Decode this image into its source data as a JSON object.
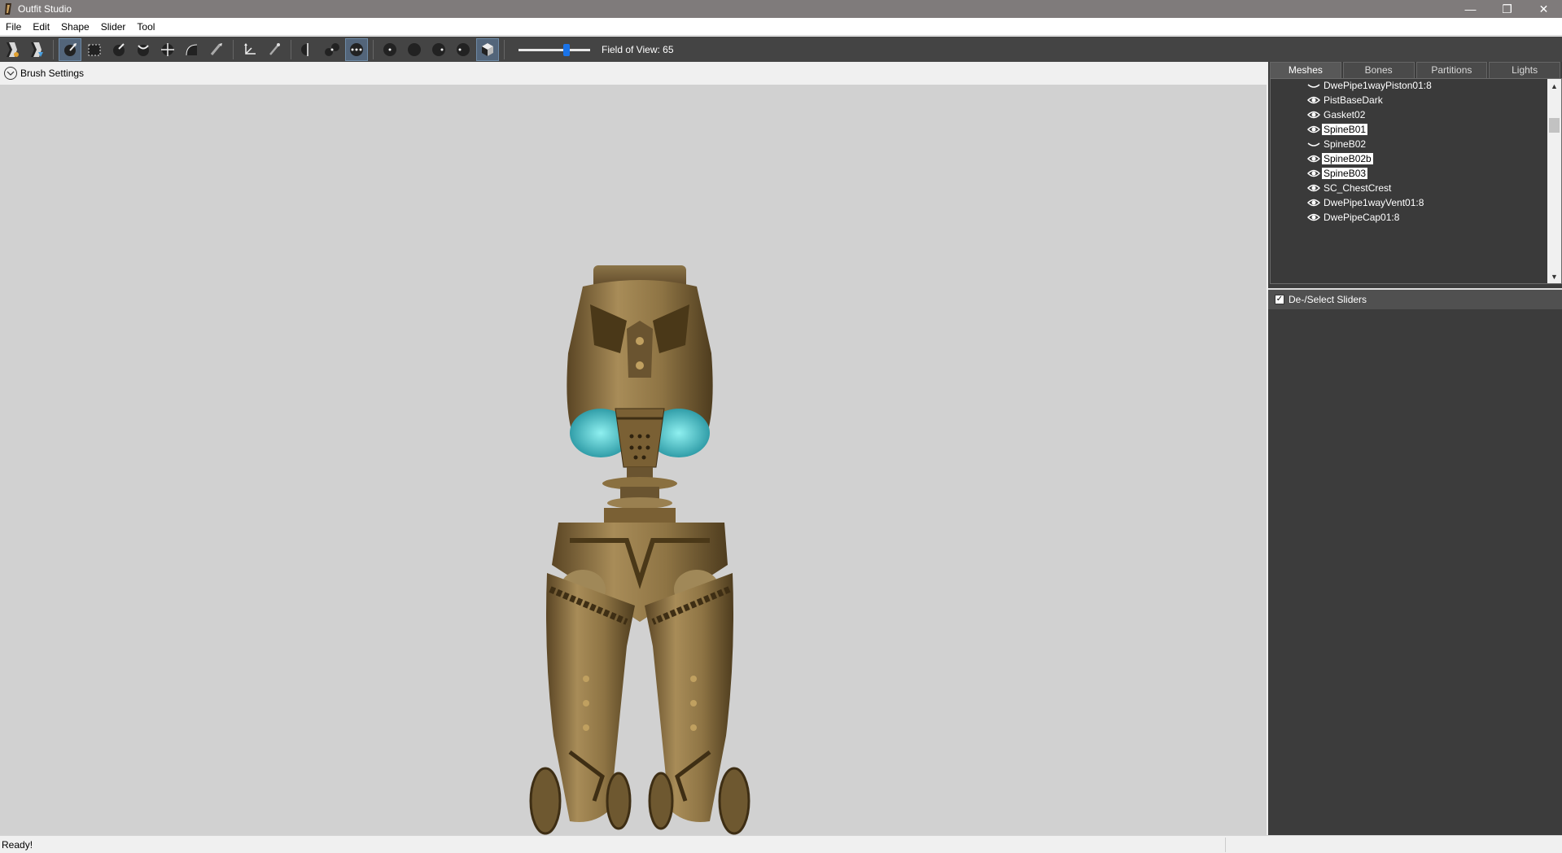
{
  "window": {
    "title": "Outfit Studio",
    "minimize_glyph": "—",
    "restore_glyph": "❐",
    "close_glyph": "✕"
  },
  "menu": [
    "File",
    "Edit",
    "Shape",
    "Slider",
    "Tool"
  ],
  "toolbar": {
    "fov_label": "Field of View: 65",
    "fov_value": 65,
    "tools": [
      "save-project-icon",
      "load-project-icon",
      "select-brush-icon",
      "mask-brush-icon",
      "inflate-brush-icon",
      "deflate-brush-icon",
      "move-brush-icon",
      "smooth-brush-icon",
      "weight-brush-icon",
      "transform-icon",
      "pivot-icon",
      "mirror-icon",
      "connected-icon",
      "symmetry-icon",
      "view-front-icon",
      "view-back-icon",
      "view-left-icon",
      "view-right-icon",
      "wireframe-toggle-icon"
    ]
  },
  "brush_settings": {
    "label": "Brush Settings"
  },
  "right_panel": {
    "tabs": [
      "Meshes",
      "Bones",
      "Partitions",
      "Lights"
    ],
    "active_tab": "Meshes",
    "meshes": [
      {
        "name": "DwePipe1wayPiston01:8",
        "visible": false,
        "selected": false
      },
      {
        "name": "PistBaseDark",
        "visible": true,
        "selected": false
      },
      {
        "name": "Gasket02",
        "visible": true,
        "selected": false
      },
      {
        "name": "SpineB01",
        "visible": true,
        "selected": true
      },
      {
        "name": "SpineB02",
        "visible": false,
        "selected": false
      },
      {
        "name": "SpineB02b",
        "visible": true,
        "selected": true
      },
      {
        "name": "SpineB03",
        "visible": true,
        "selected": true
      },
      {
        "name": "SC_ChestCrest",
        "visible": true,
        "selected": false
      },
      {
        "name": "DwePipe1wayVent01:8",
        "visible": true,
        "selected": false
      },
      {
        "name": "DwePipeCap01:8",
        "visible": true,
        "selected": false
      }
    ],
    "sliders_header": {
      "label": "De-/Select Sliders",
      "checked": true
    }
  },
  "status": {
    "text": "Ready!"
  },
  "colors": {
    "titlebar": "#7f7b7b",
    "toolbar": "#444444",
    "viewport": "#d1d1d1",
    "panel": "#3c3c3c",
    "accent": "#1a73e8",
    "model_bronze": "#8a7040",
    "model_glow": "#3ec9c9"
  }
}
